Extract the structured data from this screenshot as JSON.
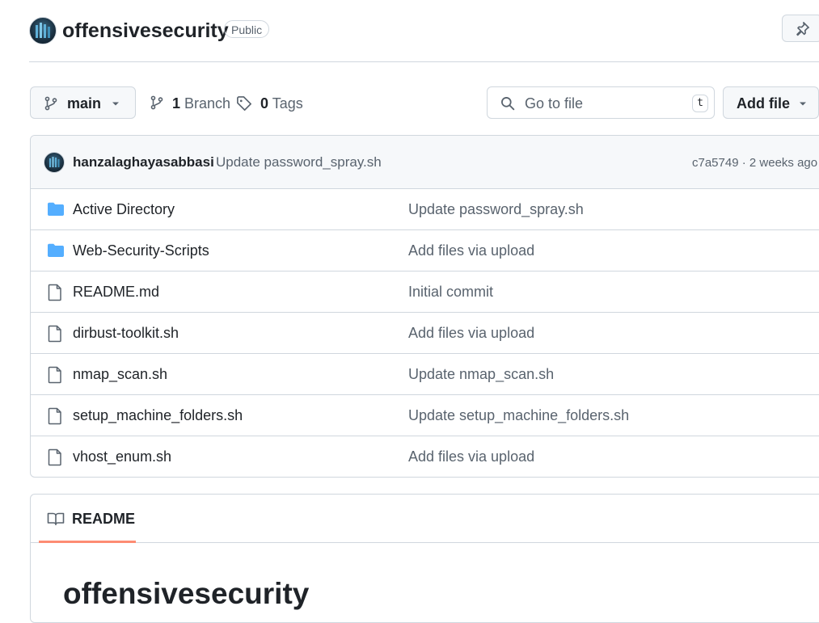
{
  "repo": {
    "name": "offensivesecurity",
    "visibility": "Public"
  },
  "toolbar": {
    "branch": "main",
    "branch_count": "1",
    "branch_label": "Branch",
    "tag_count": "0",
    "tag_label": "Tags",
    "search_placeholder": "Go to file",
    "search_shortcut": "t",
    "add_file": "Add file"
  },
  "latest_commit": {
    "author": "hanzalaghayasabbasi",
    "message": "Update password_spray.sh",
    "meta": "c7a5749 · 2 weeks ago"
  },
  "files": [
    {
      "name": "Active Directory",
      "type": "folder",
      "message": "Update password_spray.sh"
    },
    {
      "name": "Web-Security-Scripts",
      "type": "folder",
      "message": "Add files via upload"
    },
    {
      "name": "README.md",
      "type": "file",
      "message": "Initial commit"
    },
    {
      "name": "dirbust-toolkit.sh",
      "type": "file",
      "message": "Add files via upload"
    },
    {
      "name": "nmap_scan.sh",
      "type": "file",
      "message": "Update nmap_scan.sh"
    },
    {
      "name": "setup_machine_folders.sh",
      "type": "file",
      "message": "Update setup_machine_folders.sh"
    },
    {
      "name": "vhost_enum.sh",
      "type": "file",
      "message": "Add files via upload"
    }
  ],
  "readme": {
    "tab_label": "README",
    "title": "offensivesecurity"
  },
  "icons": {
    "folder": "folder-icon",
    "file": "file-icon"
  },
  "colors": {
    "folder": "#54aeff",
    "accent_underline": "#fd8c73"
  }
}
